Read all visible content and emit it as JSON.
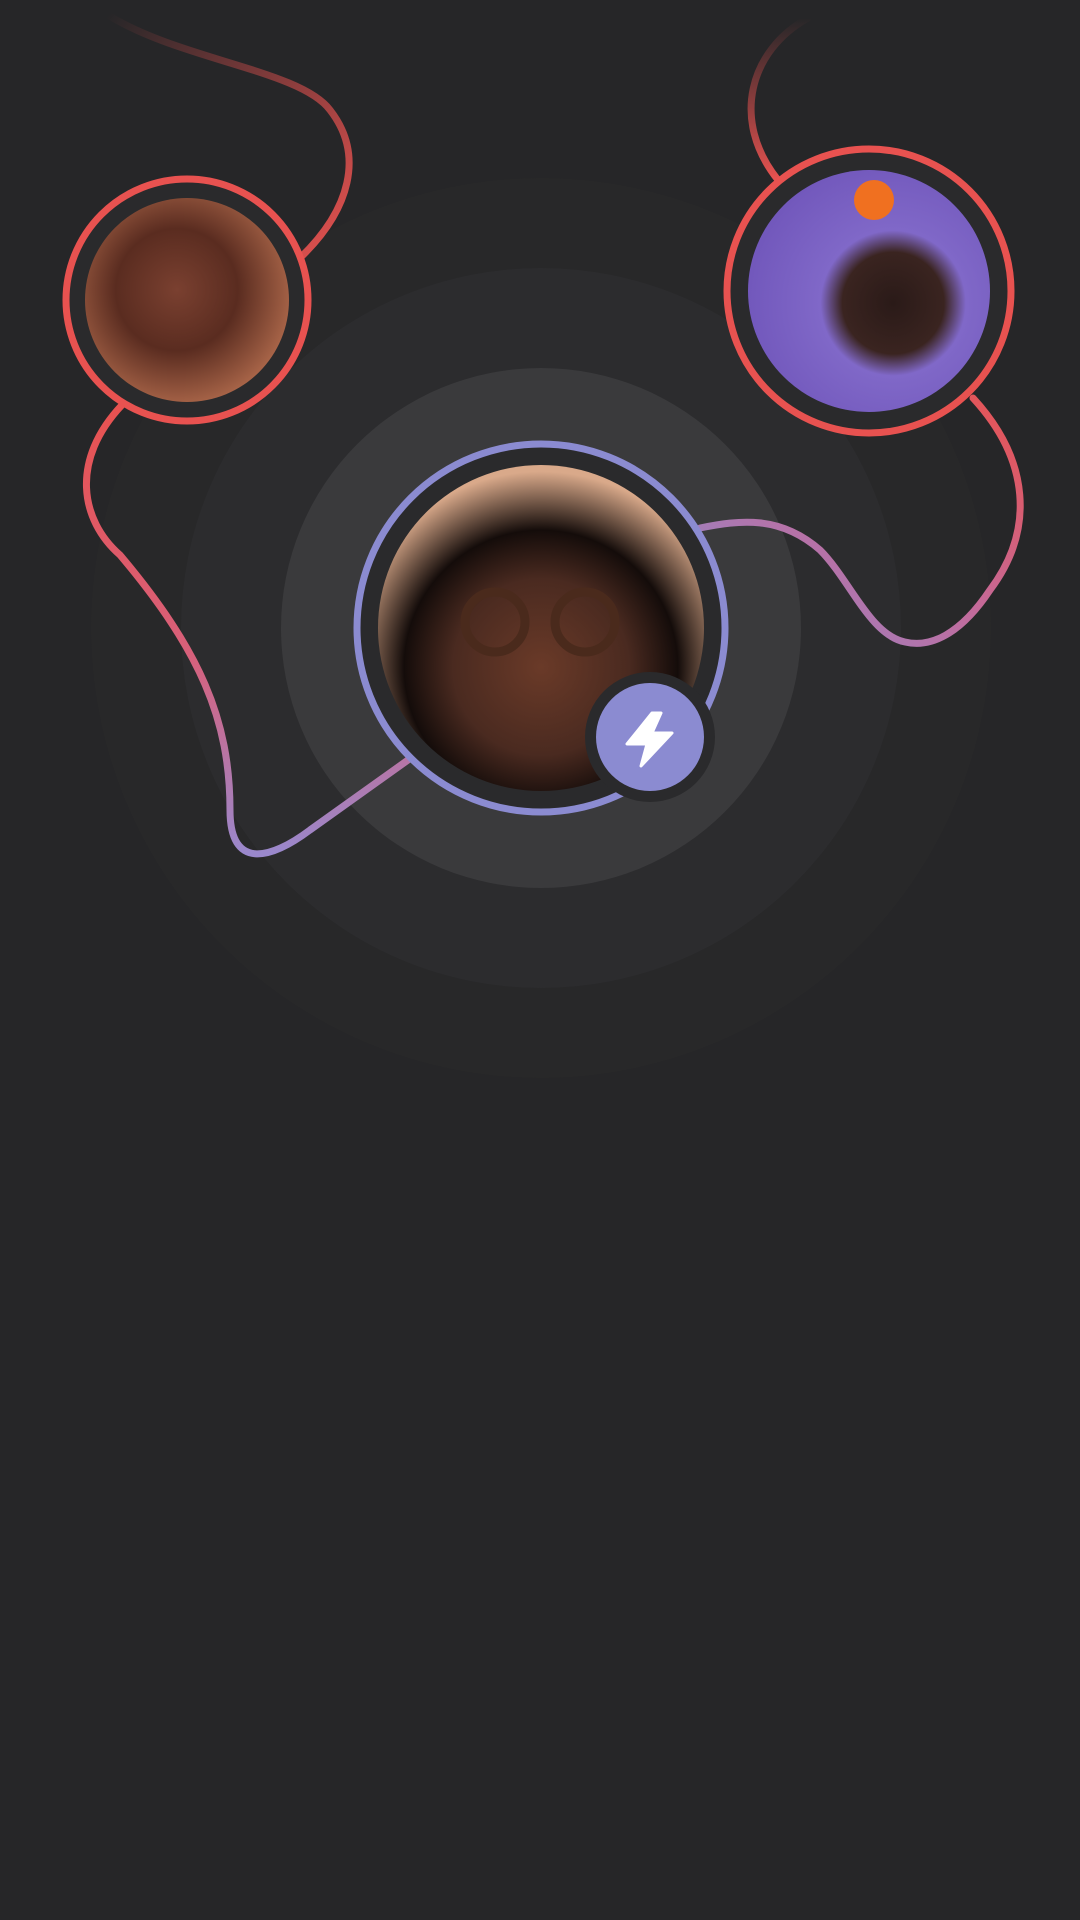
{
  "screen": {
    "name": "connections-illustration"
  },
  "colors": {
    "background": "#262628",
    "accent_red": "#e85250",
    "accent_purple": "#8b8bd1",
    "halo": "#3a3a3c",
    "ring_gap": "#2a2a2c"
  },
  "avatars": [
    {
      "id": "left",
      "icon": "avatar-photo-woman-smiling",
      "ring": "#e85250"
    },
    {
      "id": "right",
      "icon": "avatar-photo-man-orange-on-head",
      "ring": "#e85250"
    },
    {
      "id": "center",
      "icon": "avatar-photo-woman-glasses",
      "ring": "#8b8bd1"
    }
  ],
  "badge": {
    "icon": "lightning-bolt-icon",
    "color": "#8b8bd1"
  }
}
